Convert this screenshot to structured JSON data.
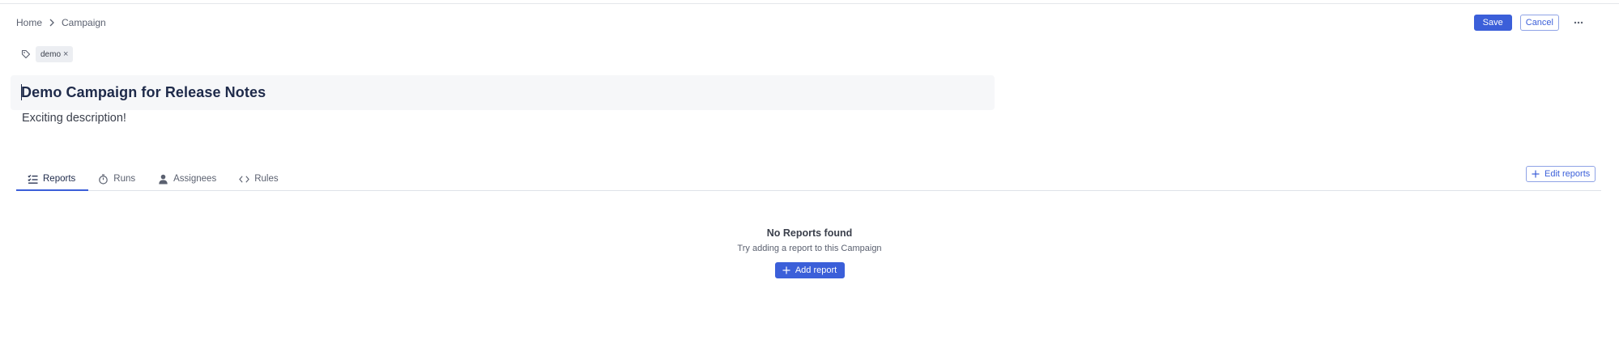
{
  "breadcrumb": {
    "home": "Home",
    "current": "Campaign"
  },
  "header": {
    "save_label": "Save",
    "cancel_label": "Cancel",
    "more_icon": "ellipsis-icon"
  },
  "tags": {
    "icon": "tag-icon",
    "items": [
      {
        "label": "demo",
        "remove": "×"
      }
    ]
  },
  "campaign": {
    "title": "Demo Campaign for Release Notes",
    "description": "Exciting description!"
  },
  "tabs": [
    {
      "label": "Reports",
      "icon": "checklist-icon",
      "active": true
    },
    {
      "label": "Runs",
      "icon": "stopwatch-icon",
      "active": false
    },
    {
      "label": "Assignees",
      "icon": "person-icon",
      "active": false
    },
    {
      "label": "Rules",
      "icon": "code-icon",
      "active": false
    }
  ],
  "toolbar": {
    "edit_reports_label": "Edit reports"
  },
  "empty_state": {
    "title": "No Reports found",
    "subtitle": "Try adding a report to this Campaign",
    "add_report_label": "Add report"
  },
  "colors": {
    "accent": "#3b5fd9",
    "title_text": "#1e2a4a",
    "title_bg": "#f6f7f9"
  }
}
